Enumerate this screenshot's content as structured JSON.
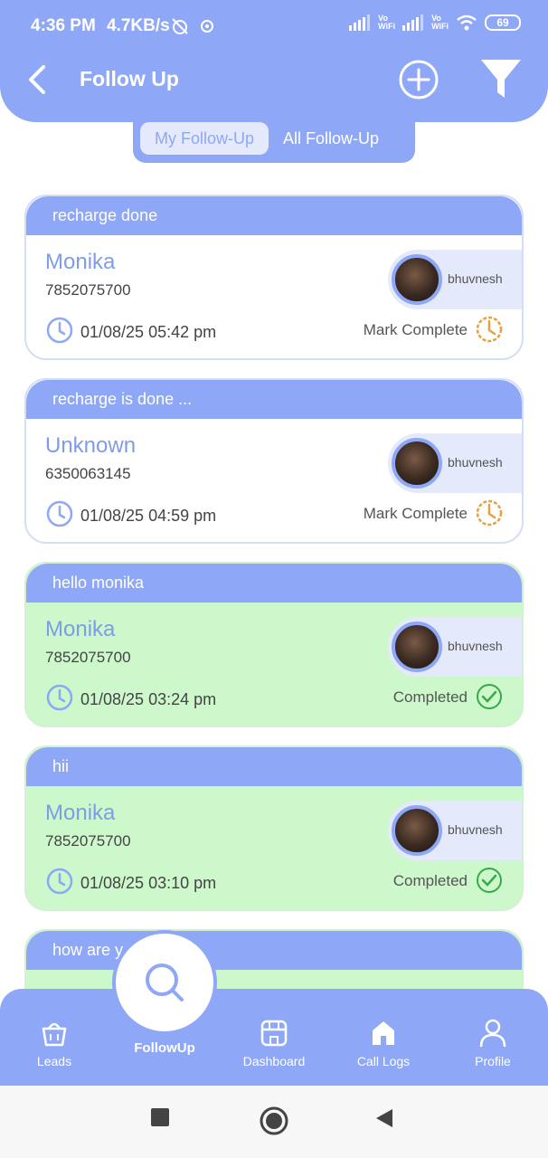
{
  "status_bar": {
    "time": "4:36 PM",
    "speed": "4.7KB/s",
    "battery": "69",
    "vowifi_top": "Vo",
    "vowifi_bottom": "WiFi"
  },
  "header": {
    "title": "Follow Up",
    "back_icon": "chevron-left-icon",
    "add_icon": "plus-circle-icon",
    "filter_icon": "filter-icon"
  },
  "tabs": [
    {
      "label": "My Follow-Up",
      "active": true
    },
    {
      "label": "All Follow-Up",
      "active": false
    }
  ],
  "cards": [
    {
      "header": "recharge done",
      "name": "Monika",
      "phone": "7852075700",
      "assignee": "bhuvnesh",
      "datetime": "01/08/25 05:42 pm",
      "status": "Mark Complete",
      "completed": false
    },
    {
      "header": "recharge is done ...",
      "name": "Unknown",
      "phone": "6350063145",
      "assignee": "bhuvnesh",
      "datetime": "01/08/25 04:59 pm",
      "status": "Mark Complete",
      "completed": false
    },
    {
      "header": "hello monika",
      "name": "Monika",
      "phone": "7852075700",
      "assignee": "bhuvnesh",
      "datetime": "01/08/25 03:24 pm",
      "status": "Completed",
      "completed": true
    },
    {
      "header": "hii",
      "name": "Monika",
      "phone": "7852075700",
      "assignee": "bhuvnesh",
      "datetime": "01/08/25 03:10 pm",
      "status": "Completed",
      "completed": true
    },
    {
      "header": "how are y"
    }
  ],
  "bottom_nav": [
    {
      "label": "Leads",
      "icon": "basket-icon"
    },
    {
      "label": "FollowUp",
      "icon": "search-icon",
      "active": true
    },
    {
      "label": "Dashboard",
      "icon": "store-icon"
    },
    {
      "label": "Call Logs",
      "icon": "home-icon"
    },
    {
      "label": "Profile",
      "icon": "user-icon"
    }
  ],
  "colors": {
    "primary": "#8ea8f7",
    "completed_bg": "#ccf8cb",
    "pending_icon": "#e6a040",
    "done_icon": "#3aa84a"
  }
}
